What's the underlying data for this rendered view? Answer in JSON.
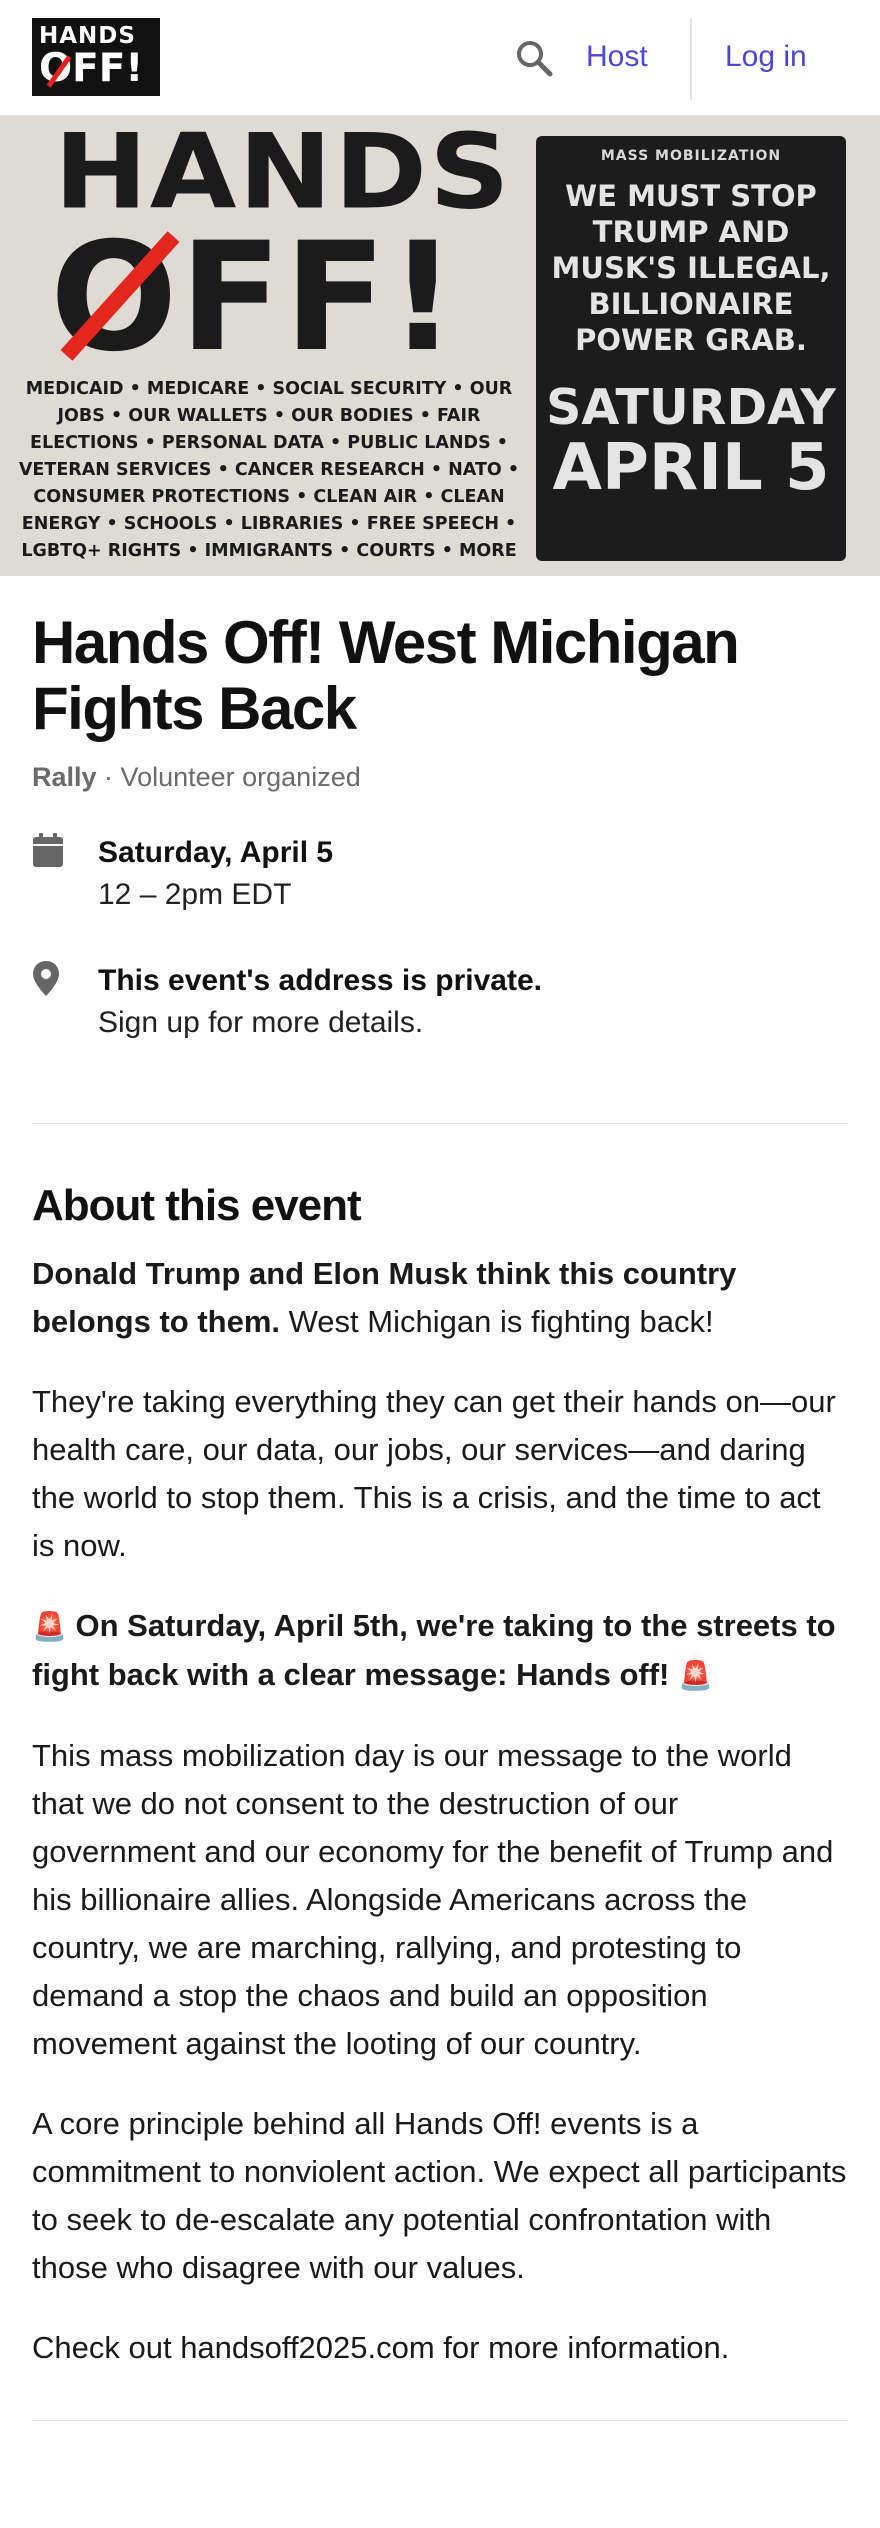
{
  "header": {
    "logo_line1": "HANDS",
    "logo_line2": "OFF!",
    "host_label": "Host",
    "login_label": "Log in",
    "accent_color": "#4f46d6"
  },
  "banner": {
    "big_word_1": "HANDS",
    "big_word_2": "OFF!",
    "issues": "MEDICAID • MEDICARE • SOCIAL SECURITY • OUR JOBS • OUR WALLETS • OUR BODIES • FAIR ELECTIONS • PERSONAL DATA • PUBLIC LANDS • VETERAN SERVICES • CANCER RESEARCH • NATO • CONSUMER PROTECTIONS • CLEAN AIR • CLEAN ENERGY • SCHOOLS • LIBRARIES • FREE SPEECH • LGBTQ+ RIGHTS • IMMIGRANTS • COURTS • MORE",
    "kicker": "MASS MOBILIZATION",
    "message": "WE MUST STOP TRUMP AND MUSK'S ILLEGAL, BILLIONAIRE POWER GRAB.",
    "date_line1": "SATURDAY",
    "date_line2": "APRIL 5"
  },
  "event": {
    "title": "Hands Off! West Michigan Fights Back",
    "type": "Rally",
    "separator": " · ",
    "organizer": "Volunteer organized",
    "date": "Saturday, April 5",
    "time": "12 – 2pm EDT",
    "location_title": "This event's address is private.",
    "location_sub": "Sign up for more details."
  },
  "about": {
    "heading": "About this event",
    "p1_bold": "Donald Trump and Elon Musk think this country belongs to them.",
    "p1_rest": " West Michigan is fighting back!",
    "p2": "They're taking everything they can get their hands on—our health care, our data, our jobs, our services—and daring the world to stop them. This is a crisis, and the time to act is now.",
    "p3_emoji": "🚨",
    "p3_bold": " On Saturday, April 5th, we're taking to the streets to fight back with a clear message: Hands off! ",
    "p4": "This mass mobilization day is our message to the world that we do not consent to the destruction of our government and our economy for the benefit of Trump and his billionaire allies. Alongside Americans across the country, we are marching, rallying, and protesting to demand a stop the chaos and build an opposition movement against the looting of our country.",
    "p5": "A core principle behind all Hands Off! events is a commitment to nonviolent action. We expect all participants to seek to de-escalate any potential confrontation with those who disagree with our values.",
    "p6": "Check out handsoff2025.com for more information."
  }
}
